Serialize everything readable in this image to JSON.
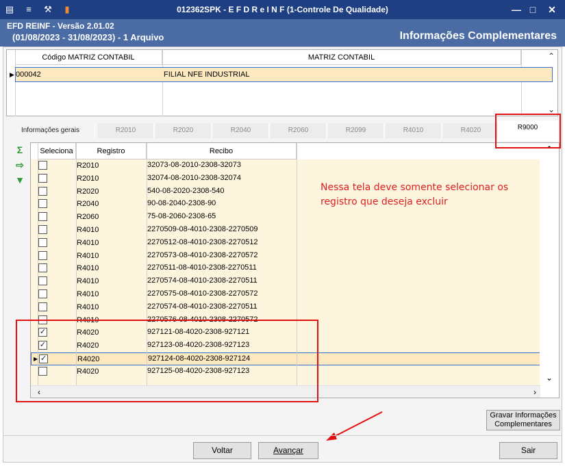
{
  "window": {
    "title": "012362SPK - E F D  R e I N F (1-Controle De Qualidade)",
    "icons": [
      "list-icon",
      "tree-icon",
      "wrench-icon",
      "app-icon"
    ],
    "controls": [
      "minimize",
      "maximize",
      "close"
    ]
  },
  "header": {
    "version": "EFD REINF - Versão 2.01.02",
    "period": "(01/08/2023 - 31/08/2023) - 1 Arquivo",
    "section": "Informações Complementares"
  },
  "top_grid": {
    "columns": [
      "Código MATRIZ CONTABIL",
      "MATRIZ CONTABIL"
    ],
    "rows": [
      {
        "code": "000042",
        "name": "FILIAL NFE INDUSTRIAL"
      }
    ]
  },
  "tabs": [
    {
      "label": "Informações gerais"
    },
    {
      "label": "R2010"
    },
    {
      "label": "R2020"
    },
    {
      "label": "R2040"
    },
    {
      "label": "R2060"
    },
    {
      "label": "R2099"
    },
    {
      "label": "R4010"
    },
    {
      "label": "R4020"
    },
    {
      "label": "R9000",
      "active": true
    }
  ],
  "side_icons": [
    "sum-icon",
    "export-icon",
    "filter-icon"
  ],
  "grid": {
    "columns": [
      "Seleciona",
      "Registro",
      "Recibo"
    ],
    "rows": [
      {
        "checked": false,
        "registro": "R2010",
        "recibo": "32073-08-2010-2308-32073"
      },
      {
        "checked": false,
        "registro": "R2010",
        "recibo": "32074-08-2010-2308-32074"
      },
      {
        "checked": false,
        "registro": "R2020",
        "recibo": "540-08-2020-2308-540"
      },
      {
        "checked": false,
        "registro": "R2040",
        "recibo": "90-08-2040-2308-90"
      },
      {
        "checked": false,
        "registro": "R2060",
        "recibo": "75-08-2060-2308-65"
      },
      {
        "checked": false,
        "registro": "R4010",
        "recibo": "2270509-08-4010-2308-2270509"
      },
      {
        "checked": false,
        "registro": "R4010",
        "recibo": "2270512-08-4010-2308-2270512"
      },
      {
        "checked": false,
        "registro": "R4010",
        "recibo": "2270573-08-4010-2308-2270572"
      },
      {
        "checked": false,
        "registro": "R4010",
        "recibo": "2270511-08-4010-2308-2270511"
      },
      {
        "checked": false,
        "registro": "R4010",
        "recibo": "2270574-08-4010-2308-2270511"
      },
      {
        "checked": false,
        "registro": "R4010",
        "recibo": "2270575-08-4010-2308-2270572"
      },
      {
        "checked": false,
        "registro": "R4010",
        "recibo": "2270574-08-4010-2308-2270511"
      },
      {
        "checked": false,
        "registro": "R4010",
        "recibo": "2270576-08-4010-2308-2270572"
      },
      {
        "checked": true,
        "registro": "R4020",
        "recibo": "927121-08-4020-2308-927121"
      },
      {
        "checked": true,
        "registro": "R4020",
        "recibo": "927123-08-4020-2308-927123"
      },
      {
        "checked": true,
        "registro": "R4020",
        "recibo": "927124-08-4020-2308-927124",
        "selected": true
      },
      {
        "checked": false,
        "registro": "R4020",
        "recibo": "927125-08-4020-2308-927123"
      }
    ]
  },
  "annotation": {
    "text": "Nessa tela deve somente selecionar os registro que deseja excluir",
    "color": "#e02020"
  },
  "buttons": {
    "gravar": "Gravar Informações Complementares",
    "voltar": "Voltar",
    "avancar": "Avançar",
    "sair": "Sair"
  },
  "colors": {
    "titlebar": "#1e3f82",
    "header": "#4a6ba3",
    "row_highlight": "#fde8bf",
    "annotation_red": "#e01010"
  }
}
